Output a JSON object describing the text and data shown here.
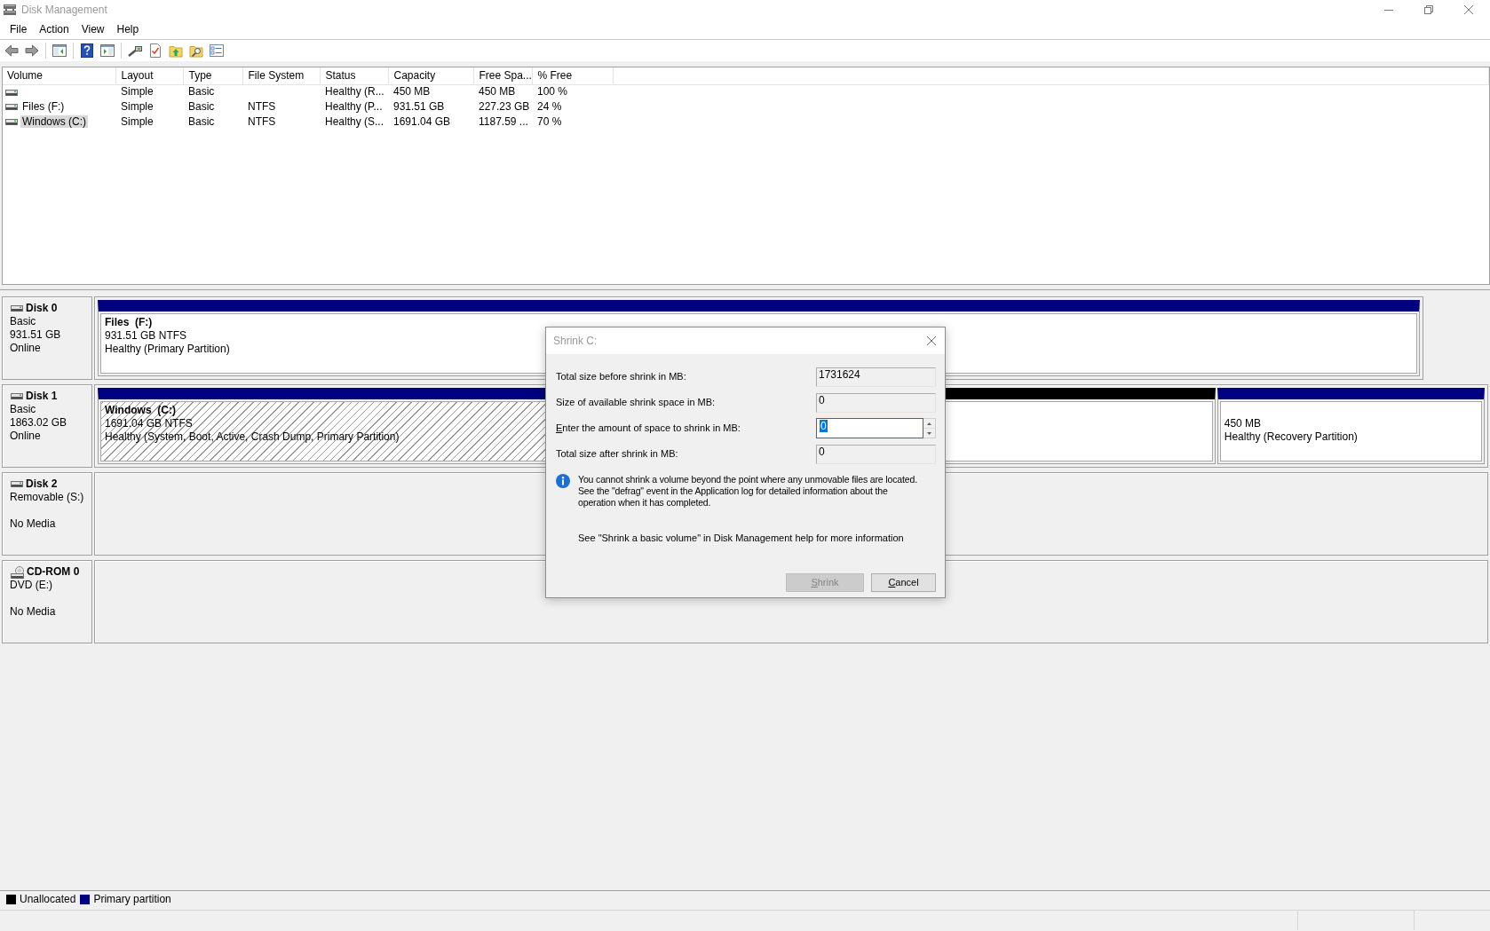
{
  "window": {
    "title": "Disk Management"
  },
  "menu": [
    "File",
    "Action",
    "View",
    "Help"
  ],
  "volume_table": {
    "columns": [
      "Volume",
      "Layout",
      "Type",
      "File System",
      "Status",
      "Capacity",
      "Free Spa...",
      "% Free"
    ],
    "rows": [
      {
        "cells": [
          null,
          "Simple",
          "Basic",
          null,
          "Healthy (R...",
          "450 MB",
          "450 MB",
          "100 %"
        ],
        "selected": false
      },
      {
        "cells": [
          "Files (F:)",
          "Simple",
          "Basic",
          "NTFS",
          "Healthy (P...",
          "931.51 GB",
          "227.23 GB",
          "24 %"
        ],
        "selected": false
      },
      {
        "cells": [
          "Windows (C:)",
          "Simple",
          "Basic",
          "NTFS",
          "Healthy (S...",
          "1691.04 GB",
          "1187.59 ...",
          "70 %"
        ],
        "selected": true
      }
    ]
  },
  "disks": [
    {
      "kind": "hdd",
      "name": "Disk 0",
      "type": "Basic",
      "size": "931.51 GB",
      "status": "Online",
      "partitions": [
        {
          "kind": "primary",
          "title": "Files  (F:)",
          "size": "931.51 GB NTFS",
          "status": "Healthy (Primary Partition)",
          "selected": false
        }
      ]
    },
    {
      "kind": "hdd",
      "name": "Disk 1",
      "type": "Basic",
      "size": "1863.02 GB",
      "status": "Online",
      "partitions": [
        {
          "kind": "primary",
          "title": "Windows  (C:)",
          "size": "1691.04 GB NTFS",
          "status": "Healthy (System, Boot, Active, Crash Dump, Primary Partition)",
          "selected": true
        },
        {
          "kind": "unallocated",
          "selected": false
        },
        {
          "kind": "primary",
          "size": "450 MB",
          "status": "Healthy (Recovery Partition)",
          "selected": false
        }
      ]
    },
    {
      "kind": "hdd",
      "name": "Disk 2",
      "type": "Removable (S:)",
      "status": "No Media"
    },
    {
      "kind": "cdrom",
      "name": "CD-ROM 0",
      "type": "DVD (E:)",
      "status": "No Media"
    }
  ],
  "legend": [
    {
      "label": "Unallocated",
      "color": "#000000"
    },
    {
      "label": "Primary partition",
      "color": "#000080"
    }
  ],
  "dialog": {
    "title": "Shrink C:",
    "fields": [
      {
        "kind": "readonly",
        "label": "Total size before shrink in MB:",
        "value": "1731624"
      },
      {
        "kind": "readonly",
        "label": "Size of available shrink space in MB:",
        "value": "0"
      },
      {
        "kind": "spin",
        "label": "Enter the amount of space to shrink in MB:",
        "value": "0",
        "focused": true
      },
      {
        "kind": "readonly",
        "label": "Total size after shrink in MB:",
        "value": "0"
      }
    ],
    "info": "You cannot shrink a volume beyond the point where any unmovable files are located. See the \"defrag\" event in the Application log for detailed information about the operation when it has completed.",
    "help": "See \"Shrink a basic volume\" in Disk Management help for more information",
    "buttons": [
      {
        "label": "Shrink",
        "disabled": true
      },
      {
        "label": "Cancel",
        "disabled": false
      }
    ]
  }
}
